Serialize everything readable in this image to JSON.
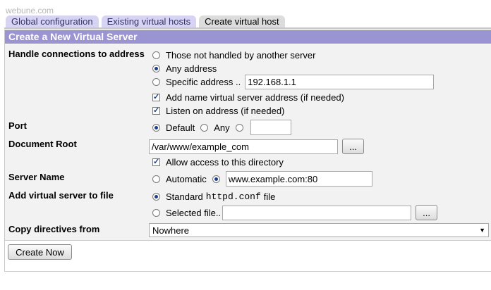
{
  "watermark": "webune.com",
  "tabs": [
    {
      "label": "Global configuration",
      "active": false
    },
    {
      "label": "Existing virtual hosts",
      "active": false
    },
    {
      "label": "Create virtual host",
      "active": true
    }
  ],
  "panel": {
    "title": "Create a New Virtual Server"
  },
  "form": {
    "address": {
      "label": "Handle connections to address",
      "opt_not_handled": "Those not handled by another server",
      "opt_any": "Any address",
      "opt_specific": "Specific address ..",
      "specific_value": "192.168.1.1",
      "add_name_label": "Add name virtual server address (if needed)",
      "listen_label": "Listen on address (if needed)"
    },
    "port": {
      "label": "Port",
      "opt_default": "Default",
      "opt_any": "Any",
      "value": ""
    },
    "docroot": {
      "label": "Document Root",
      "value": "/var/www/example_com",
      "browse": "...",
      "allow_label": "Allow access to this directory"
    },
    "server_name": {
      "label": "Server Name",
      "opt_automatic": "Automatic",
      "value": "www.example.com:80"
    },
    "add_to_file": {
      "label": "Add virtual server to file",
      "opt_standard_prefix": "Standard",
      "opt_standard_file": "httpd.conf",
      "opt_standard_suffix": "file",
      "opt_selected": "Selected file..",
      "selected_value": "",
      "browse": "..."
    },
    "copy_directives": {
      "label": "Copy directives from",
      "selected": "Nowhere"
    }
  },
  "actions": {
    "create_label": "Create Now"
  },
  "colors": {
    "header_bg": "#9a94d2",
    "tab_bg": "#d6d3f3",
    "active_tab_bg": "#dcdcdc",
    "form_bg": "#f2f2f2"
  }
}
